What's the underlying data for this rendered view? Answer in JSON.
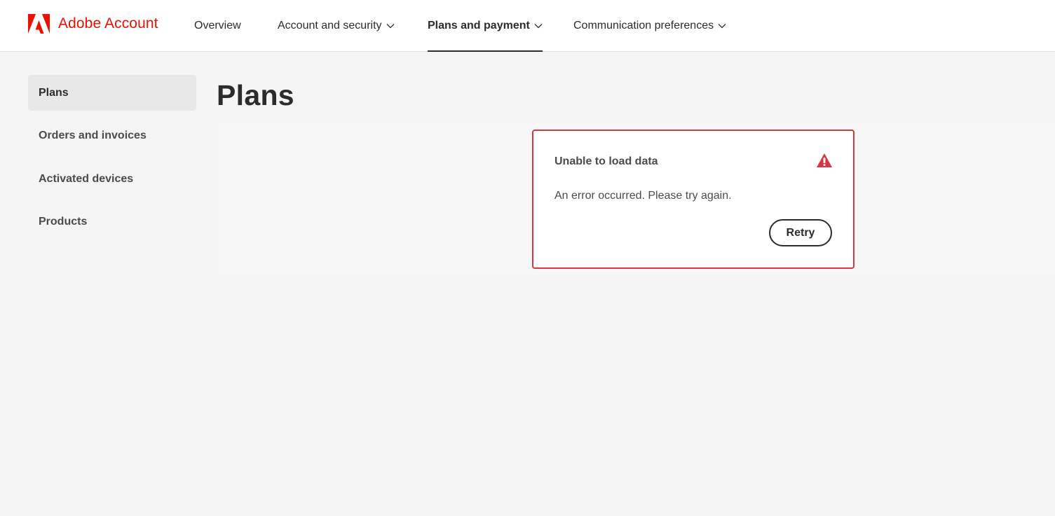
{
  "header": {
    "brand": "Adobe Account",
    "brand_color": "#eb1000",
    "logo_icon": "adobe-logo-icon",
    "nav": [
      {
        "label": "Overview",
        "has_dropdown": false,
        "active": false
      },
      {
        "label": "Account and security",
        "has_dropdown": true,
        "active": false
      },
      {
        "label": "Plans and payment",
        "has_dropdown": true,
        "active": true
      },
      {
        "label": "Communication preferences",
        "has_dropdown": true,
        "active": false
      }
    ]
  },
  "sidebar": {
    "items": [
      {
        "label": "Plans",
        "selected": true
      },
      {
        "label": "Orders and invoices",
        "selected": false
      },
      {
        "label": "Activated devices",
        "selected": false
      },
      {
        "label": "Products",
        "selected": false
      }
    ]
  },
  "main": {
    "title": "Plans",
    "error": {
      "title": "Unable to load data",
      "message": "An error occurred. Please try again.",
      "icon": "alert-triangle-icon",
      "accent_color": "#d7373f",
      "retry_label": "Retry"
    }
  }
}
